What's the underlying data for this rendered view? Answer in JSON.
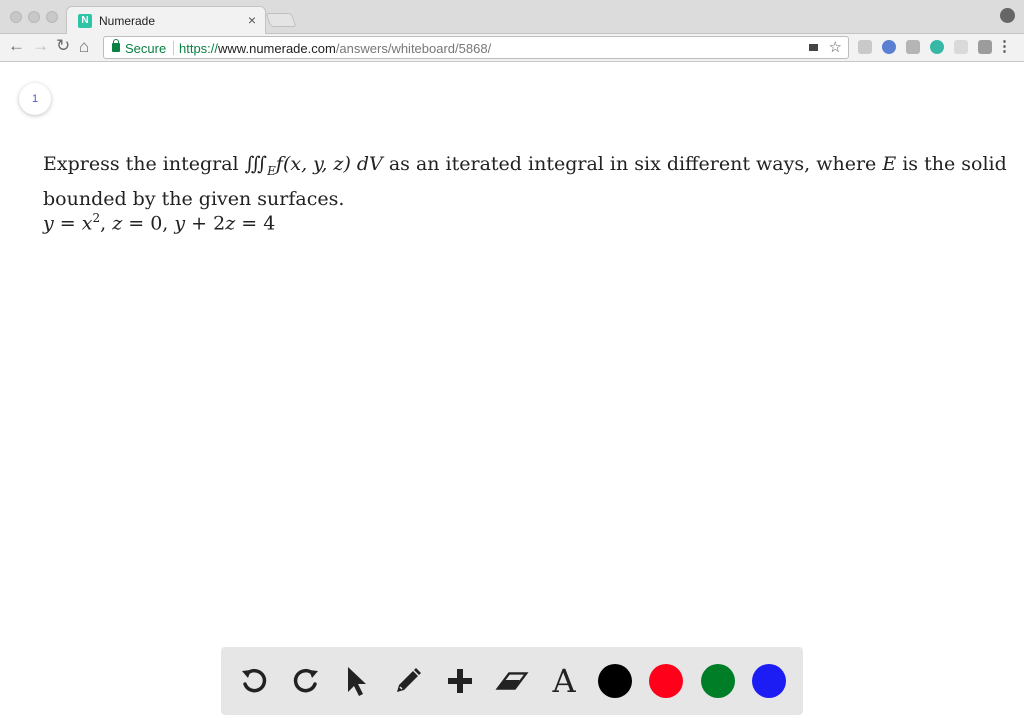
{
  "browser": {
    "tab_title": "Numerade",
    "favicon_letter": "N",
    "tab_close": "×",
    "secure_label": "Secure",
    "url_scheme": "https://",
    "url_host": "www.numerade.com",
    "url_path": "/answers/whiteboard/5868/"
  },
  "page": {
    "page_number": "1",
    "problem": {
      "intro": "Express the integral ",
      "integral_symbol": "∭",
      "integral_subscript": "E",
      "integrand": "f",
      "args": "(x, y, z)",
      "dv": " dV",
      "middle": " as an iterated integral in six different ways, where ",
      "region": "E",
      "end": " is the solid bounded by the given surfaces."
    },
    "equation": {
      "part1": "y",
      "part2": " = ",
      "part3": "x",
      "exp": "2",
      "part4": ", ",
      "part5": "z",
      "part6": " = 0, ",
      "part7": "y",
      "part8": " + 2",
      "part9": "z",
      "part10": " = 4"
    }
  },
  "whiteboard_toolbar": {
    "tools": [
      "undo-icon",
      "redo-icon",
      "cursor-icon",
      "pencil-icon",
      "plus-icon",
      "eraser-icon",
      "text-icon"
    ],
    "text_tool_glyph": "A",
    "colors": [
      "#000000",
      "#fe0019",
      "#007d27",
      "#1c1cf5"
    ]
  }
}
